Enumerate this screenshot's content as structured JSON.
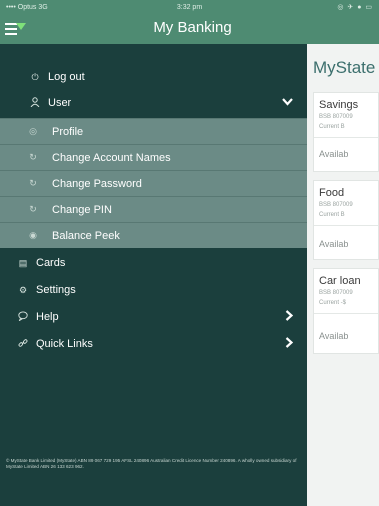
{
  "status_bar": {
    "carrier": "•••• Optus 3G",
    "time": "3:32 pm",
    "icons": "◎ ✈ ● ▭"
  },
  "header": {
    "title": "My Banking"
  },
  "sidebar": {
    "logout": {
      "label": "Log out",
      "icon": "logout-icon"
    },
    "user": {
      "label": "User",
      "icon": "user-icon",
      "expanded": true
    },
    "user_items": [
      {
        "label": "Profile",
        "icon": "profile-icon"
      },
      {
        "label": "Change Account Names",
        "icon": "refresh-icon"
      },
      {
        "label": "Change Password",
        "icon": "refresh-icon"
      },
      {
        "label": "Change PIN",
        "icon": "refresh-icon"
      },
      {
        "label": "Balance Peek",
        "icon": "eye-icon"
      }
    ],
    "cards": {
      "label": "Cards",
      "icon": "cards-icon"
    },
    "settings": {
      "label": "Settings",
      "icon": "gear-icon"
    },
    "help": {
      "label": "Help",
      "icon": "chat-bubble-icon"
    },
    "quick_links": {
      "label": "Quick Links",
      "icon": "link-icon"
    },
    "footer_text": "© MyState Bank Limited (MyState) ABN 89 067 729 195 AFSL 240896 Australian Credit Licence Number 240896. A wholly owned subsidiary of MyState Limited ABN 26 133 623 962."
  },
  "content": {
    "heading": "MyState",
    "accounts": [
      {
        "name": "Savings",
        "bsb": "BSB 807009",
        "current": "Current B",
        "available": "Availab"
      },
      {
        "name": "Food",
        "bsb": "BSB 807009",
        "current": "Current B",
        "available": "Availab"
      },
      {
        "name": "Car loan",
        "bsb": "BSB 807009",
        "current": "Current -$",
        "available": "Availab"
      }
    ]
  },
  "colors": {
    "header_bg": "#4e8b72",
    "sidebar_bg": "#1b3f3d",
    "submenu_bg": "#6b8b86",
    "menu_accent": "#7fe07a",
    "heading_text": "#3c6f6d"
  }
}
